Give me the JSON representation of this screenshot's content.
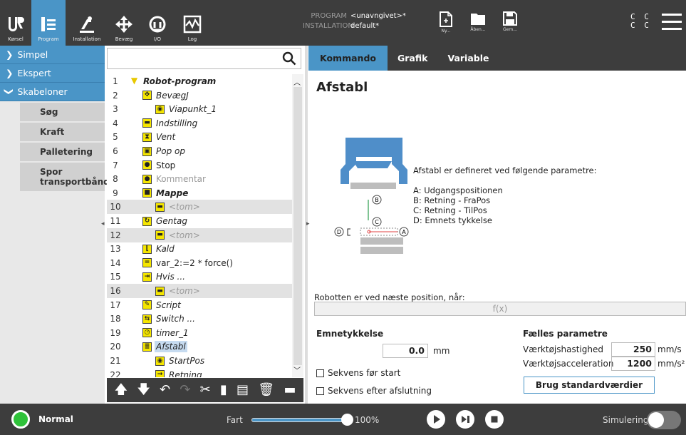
{
  "topbar": {
    "nav": [
      {
        "label": "Kørsel",
        "icon": "ur-logo-icon"
      },
      {
        "label": "Program",
        "icon": "program-icon",
        "active": true
      },
      {
        "label": "Installation",
        "icon": "installation-icon"
      },
      {
        "label": "Bevæg",
        "icon": "move-icon"
      },
      {
        "label": "I/O",
        "icon": "io-icon"
      },
      {
        "label": "Log",
        "icon": "log-icon"
      }
    ],
    "program_key": "PROGRAM",
    "program_value": "<unavngivet>*",
    "installation_key": "INSTALLATION",
    "installation_value": "default*",
    "file_buttons": [
      {
        "label": "Ny...",
        "icon": "new-file-icon"
      },
      {
        "label": "Åben...",
        "icon": "open-folder-icon"
      },
      {
        "label": "Gem...",
        "icon": "save-icon"
      }
    ],
    "cc_row1": "C C",
    "cc_row2": "C C"
  },
  "leftnav": {
    "sections": [
      "Simpel",
      "Ekspert",
      "Skabeloner"
    ],
    "templates": [
      "Søg",
      "Kraft",
      "Palletering",
      "Spor transportbånd"
    ]
  },
  "search": {
    "placeholder": "",
    "value": ""
  },
  "tree": [
    {
      "num": "1",
      "label": "Robot-program",
      "style": "boldi",
      "indent": 0,
      "icon": "▼"
    },
    {
      "num": "2",
      "label": "BevægJ",
      "style": "italic",
      "indent": 1,
      "icon": "✥"
    },
    {
      "num": "3",
      "label": "Viapunkt_1",
      "style": "italic",
      "indent": 2,
      "icon": "◉"
    },
    {
      "num": "4",
      "label": "Indstilling",
      "style": "italic",
      "indent": 1,
      "icon": "▬"
    },
    {
      "num": "5",
      "label": "Vent",
      "style": "italic",
      "indent": 1,
      "icon": "⧗"
    },
    {
      "num": "6",
      "label": "Pop op",
      "style": "italic",
      "indent": 1,
      "icon": "▣"
    },
    {
      "num": "7",
      "label": "Stop",
      "style": "",
      "indent": 1,
      "icon": "●"
    },
    {
      "num": "8",
      "label": "Kommentar",
      "style": "muted-plain",
      "indent": 1,
      "icon": "●"
    },
    {
      "num": "9",
      "label": "Mappe",
      "style": "boldi",
      "indent": 1,
      "icon": "■"
    },
    {
      "num": "10",
      "label": "<tom>",
      "style": "muted",
      "indent": 2,
      "icon": "▬",
      "grey": true
    },
    {
      "num": "11",
      "label": "Gentag",
      "style": "italic",
      "indent": 1,
      "icon": "↻"
    },
    {
      "num": "12",
      "label": "<tom>",
      "style": "muted",
      "indent": 2,
      "icon": "▬",
      "grey": true
    },
    {
      "num": "13",
      "label": "Kald",
      "style": "italic",
      "indent": 1,
      "icon": "⌊"
    },
    {
      "num": "14",
      "label": "var_2:=2 * force()",
      "style": "",
      "indent": 1,
      "icon": "="
    },
    {
      "num": "15",
      "label": "Hvis ...",
      "style": "italic",
      "indent": 1,
      "icon": "⇥"
    },
    {
      "num": "16",
      "label": "<tom>",
      "style": "muted",
      "indent": 2,
      "icon": "▬",
      "grey": true
    },
    {
      "num": "17",
      "label": "Script",
      "style": "italic",
      "indent": 1,
      "icon": "✎"
    },
    {
      "num": "18",
      "label": "Switch ...",
      "style": "italic",
      "indent": 1,
      "icon": "⇆"
    },
    {
      "num": "19",
      "label": "timer_1",
      "style": "italic",
      "indent": 1,
      "icon": "◷"
    },
    {
      "num": "20",
      "label": "Afstabl",
      "style": "italic",
      "indent": 1,
      "icon": "≣",
      "selected": true
    },
    {
      "num": "21",
      "label": "StartPos",
      "style": "italic",
      "indent": 2,
      "icon": "◉"
    },
    {
      "num": "22",
      "label": "Retning",
      "style": "italic",
      "indent": 2,
      "icon": "→"
    }
  ],
  "tree_tools": [
    "arrow-up-icon",
    "arrow-down-icon",
    "undo-icon",
    "redo-icon",
    "cut-icon",
    "copy-icon",
    "paste-icon",
    "delete-icon",
    "suppress-icon"
  ],
  "tabs": [
    "Kommando",
    "Grafik",
    "Variable"
  ],
  "panel": {
    "title": "Afstabl",
    "params_intro": "Afstabl er defineret ved følgende parametre:",
    "params": [
      "A: Udgangspositionen",
      "B: Retning - FraPos",
      "C: Retning - TilPos",
      "D: Emnets tykkelse"
    ],
    "diagram_labels": {
      "a": "A",
      "b": "B",
      "c": "C",
      "d": "D"
    },
    "cond_label": "Robotten er ved næste position, når:",
    "cond_value": "f(x)",
    "thickness_heading": "Emnetykkelse",
    "thickness_value": "0.0",
    "thickness_unit": "mm",
    "check_before": "Sekvens før start",
    "check_after": "Sekvens efter afslutning",
    "shared_heading": "Fælles parametre",
    "tool_speed_label": "Værktøjshastighed",
    "tool_speed_value": "250",
    "tool_speed_unit": "mm/s",
    "tool_acc_label": "Værktøjsacceleration",
    "tool_acc_value": "1200",
    "tool_acc_unit": "mm/s²",
    "default_button": "Brug standardværdier"
  },
  "bottombar": {
    "status": "Normal",
    "speed_label": "Fart",
    "speed_value": "100%",
    "speed_fraction": 1.0,
    "sim_label": "Simulering",
    "sim_on": false
  },
  "colors": {
    "accent": "#4a95c7",
    "bar": "#3d3d3d",
    "status_green": "#2fc23a",
    "icon_yellow": "#f5e600"
  }
}
